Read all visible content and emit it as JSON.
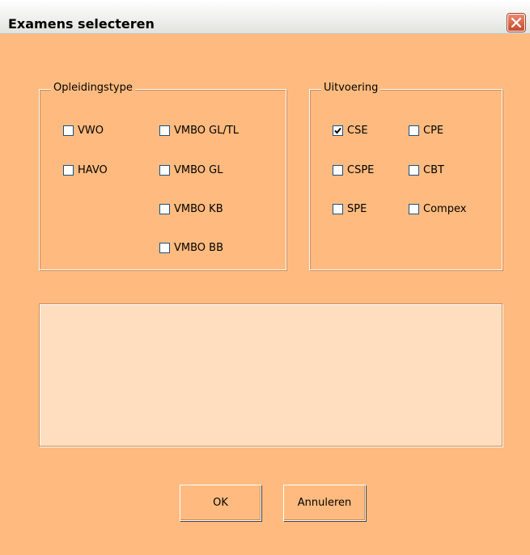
{
  "window": {
    "title": "Examens selecteren"
  },
  "opleidingstype": {
    "caption": "Opleidingstype",
    "options": [
      {
        "label": "VWO",
        "checked": false
      },
      {
        "label": "HAVO",
        "checked": false
      },
      {
        "label": "VMBO GL/TL",
        "checked": false
      },
      {
        "label": "VMBO GL",
        "checked": false
      },
      {
        "label": "VMBO KB",
        "checked": false
      },
      {
        "label": "VMBO BB",
        "checked": false
      }
    ]
  },
  "uitvoering": {
    "caption": "Uitvoering",
    "options": [
      {
        "label": "CSE",
        "checked": true
      },
      {
        "label": "CPE",
        "checked": false
      },
      {
        "label": "CSPE",
        "checked": false
      },
      {
        "label": "CBT",
        "checked": false
      },
      {
        "label": "SPE",
        "checked": false
      },
      {
        "label": "Compex",
        "checked": false
      }
    ]
  },
  "buttons": {
    "ok": "OK",
    "cancel": "Annuleren"
  },
  "colors": {
    "dialog_bg": "#ffbb7f",
    "listbox_bg": "#ffdebf",
    "close_red": "#c64a2c"
  }
}
